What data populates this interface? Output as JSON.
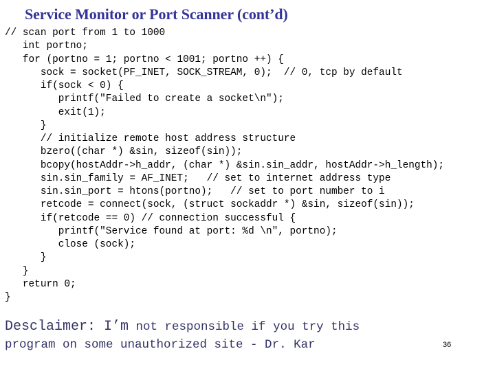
{
  "slide": {
    "title": "Service Monitor or Port Scanner (cont’d)",
    "code_lines": [
      "// scan port from 1 to 1000",
      "   int portno;",
      "   for (portno = 1; portno < 1001; portno ++) {",
      "      sock = socket(PF_INET, SOCK_STREAM, 0);  // 0, tcp by default",
      "      if(sock < 0) {",
      "         printf(\"Failed to create a socket\\n\");",
      "         exit(1);",
      "      }",
      "      // initialize remote host address structure",
      "      bzero((char *) &sin, sizeof(sin));",
      "      bcopy(hostAddr->h_addr, (char *) &sin.sin_addr, hostAddr->h_length);",
      "      sin.sin_family = AF_INET;   // set to internet address type",
      "      sin.sin_port = htons(portno);   // set to port number to i",
      "      retcode = connect(sock, (struct sockaddr *) &sin, sizeof(sin));",
      "      if(retcode == 0) // connection successful {",
      "         printf(\"Service found at port: %d \\n\", portno);",
      "         close (sock);",
      "      }",
      "   }",
      "   return 0;",
      "}"
    ],
    "disclaimer": {
      "line1_large": "Desclaimer: I’m",
      "line1_small": " not responsible if you try this",
      "line2": "program on some unauthorized site - Dr. Kar"
    },
    "page_number": "36",
    "colors": {
      "title": "#333399",
      "disclaimer": "#333366",
      "code": "#000000"
    }
  }
}
